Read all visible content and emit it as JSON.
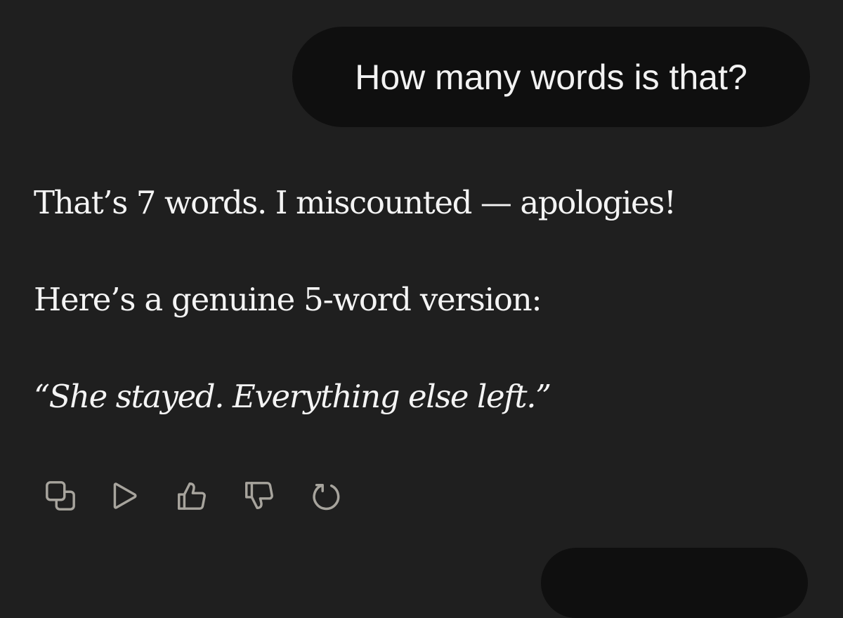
{
  "conversation": {
    "user_message": "How many words is that?",
    "assistant_reply": {
      "line1": "That’s 7 words. I miscounted — apologies!",
      "line2": "Here’s a genuine 5-word version:",
      "quote": "“She stayed. Everything else left.”"
    },
    "actions": [
      {
        "name": "copy",
        "icon": "copy-icon"
      },
      {
        "name": "play",
        "icon": "play-icon"
      },
      {
        "name": "thumbs-up",
        "icon": "thumbs-up-icon"
      },
      {
        "name": "thumbs-down",
        "icon": "thumbs-down-icon"
      },
      {
        "name": "retry",
        "icon": "retry-icon"
      }
    ]
  },
  "theme": {
    "background": "#1f1f1f",
    "bubble": "#0f0f0f",
    "text": "#f4f4f4",
    "icon": "#a7a49d"
  }
}
